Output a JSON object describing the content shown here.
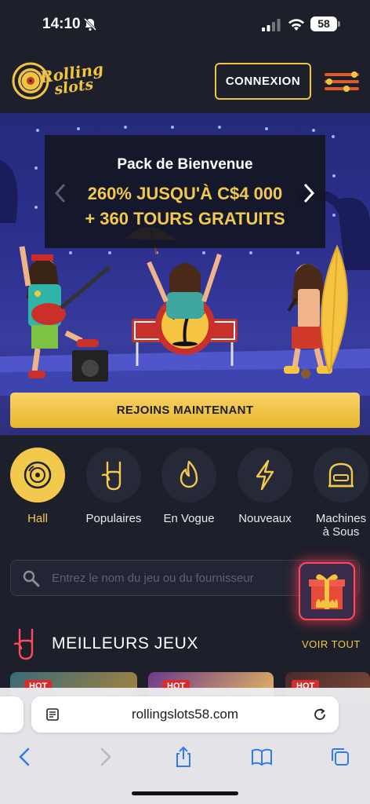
{
  "status": {
    "time": "14:10",
    "battery": "58"
  },
  "header": {
    "logo_line1": "Rolling",
    "logo_line2": "slots",
    "login_label": "CONNEXION"
  },
  "hero": {
    "title": "Pack de Bienvenue",
    "line1": "260% JUSQU'À C$4 000",
    "line2": "+ 360 TOURS GRATUITS",
    "join_label": "REJOINS MAINTENANT"
  },
  "categories": [
    {
      "label": "Hall",
      "icon": "disc-icon",
      "active": true
    },
    {
      "label": "Populaires",
      "icon": "rock-hand-icon"
    },
    {
      "label": "En Vogue",
      "icon": "flame-icon"
    },
    {
      "label": "Nouveaux",
      "icon": "lightning-icon"
    },
    {
      "label_line1": "Machines",
      "label_line2": "à Sous",
      "icon": "slot-machine-icon"
    }
  ],
  "search": {
    "placeholder": "Entrez le nom du jeu ou du fournisseur"
  },
  "best_games": {
    "title": "MEILLEURS JEUX",
    "see_all": "VOIR TOUT",
    "badge": "HOT"
  },
  "browser": {
    "url": "rollingslots58.com"
  },
  "colors": {
    "accent": "#f2c94c",
    "background": "#1d1f2b",
    "hero_bg": "#2c2f8c"
  }
}
